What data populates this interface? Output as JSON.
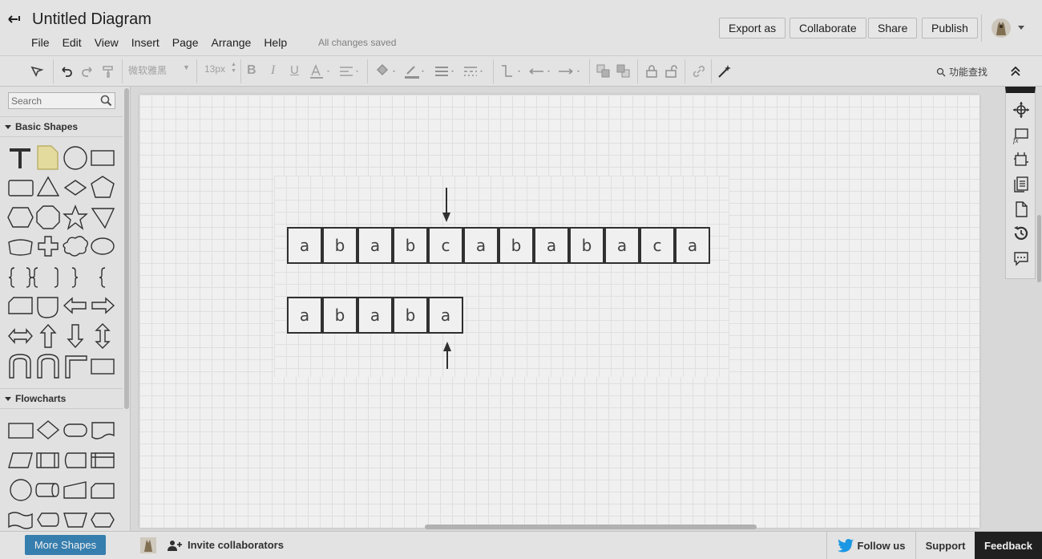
{
  "header": {
    "title": "Untitled Diagram",
    "menus": [
      "File",
      "Edit",
      "View",
      "Insert",
      "Page",
      "Arrange",
      "Help"
    ],
    "save_status": "All changes saved",
    "buttons": {
      "export": "Export as",
      "collaborate": "Collaborate",
      "share": "Share",
      "publish": "Publish"
    }
  },
  "toolbar": {
    "font": "微软雅黑",
    "font_size": "13px",
    "find_label": "功能查找"
  },
  "sidebar": {
    "search_placeholder": "Search",
    "sections": {
      "basic": "Basic Shapes",
      "flowcharts": "Flowcharts"
    }
  },
  "diagram": {
    "text_chars": [
      "a",
      "b",
      "a",
      "b",
      "c",
      "a",
      "b",
      "a",
      "b",
      "a",
      "c",
      "a"
    ],
    "pattern_chars": [
      "a",
      "b",
      "a",
      "b",
      "a"
    ]
  },
  "footer": {
    "more_shapes": "More Shapes",
    "invite": "Invite collaborators",
    "follow": "Follow us",
    "support": "Support",
    "feedback": "Feedback"
  },
  "colors": {
    "accent": "#3a86b9",
    "feedback_bg": "#222222",
    "twitter": "#1da1f2"
  }
}
